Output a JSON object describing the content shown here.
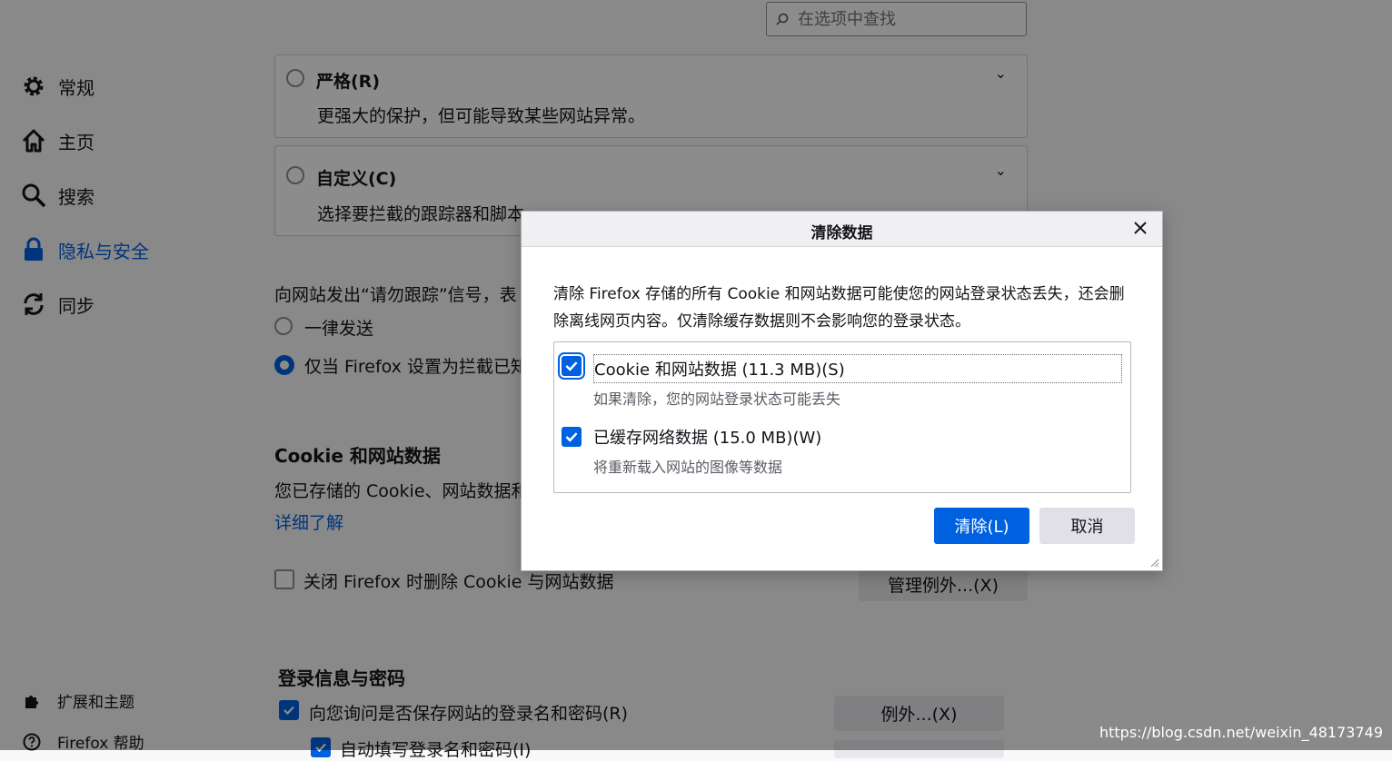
{
  "search": {
    "placeholder": "在选项中查找"
  },
  "sidebar": {
    "items": [
      {
        "label": "常规",
        "icon": "gear-icon"
      },
      {
        "label": "主页",
        "icon": "home-icon"
      },
      {
        "label": "搜索",
        "icon": "search-icon"
      },
      {
        "label": "隐私与安全",
        "icon": "lock-icon",
        "active": true
      },
      {
        "label": "同步",
        "icon": "sync-icon"
      }
    ],
    "footer": [
      {
        "label": "扩展和主题",
        "icon": "puzzle-icon"
      },
      {
        "label": "Firefox 帮助",
        "icon": "help-icon"
      }
    ]
  },
  "tracking": {
    "strict": {
      "title": "严格(R)",
      "desc": "更强大的保护，但可能导致某些网站异常。"
    },
    "custom": {
      "title": "自定义(C)",
      "desc": "选择要拦截的跟踪器和脚本"
    }
  },
  "dnt": {
    "label": "向网站发出“请勿跟踪”信号，表",
    "option_always": "一律发送",
    "option_only": "仅当 Firefox 设置为拦截已知"
  },
  "cookies": {
    "heading": "Cookie 和网站数据",
    "desc": "您已存储的 Cookie、网站数据和",
    "learn_more": "详细了解",
    "delete_on_close": "关闭 Firefox 时删除 Cookie 与网站数据",
    "manage_exceptions": "管理例外...(X)"
  },
  "logins": {
    "heading": "登录信息与密码",
    "ask_save": "向您询问是否保存网站的登录名和密码(R)",
    "autofill": "自动填写登录名和密码(I)",
    "exceptions": "例外...(X)"
  },
  "dialog": {
    "title": "清除数据",
    "description": "清除 Firefox 存储的所有 Cookie 和网站数据可能使您的网站登录状态丢失，还会删除离线网页内容。仅清除缓存数据则不会影响您的登录状态。",
    "option1": {
      "label": "Cookie 和网站数据 (11.3 MB)(S)",
      "sub": "如果清除，您的网站登录状态可能丢失",
      "checked": true
    },
    "option2": {
      "label": "已缓存网络数据 (15.0 MB)(W)",
      "sub": "将重新载入网站的图像等数据",
      "checked": true
    },
    "clear_button": "清除(L)",
    "cancel_button": "取消"
  },
  "watermark": "https://blog.csdn.net/weixin_48173749",
  "colors": {
    "accent": "#0061e0",
    "overlay": "rgba(0,0,0,0.45)"
  }
}
